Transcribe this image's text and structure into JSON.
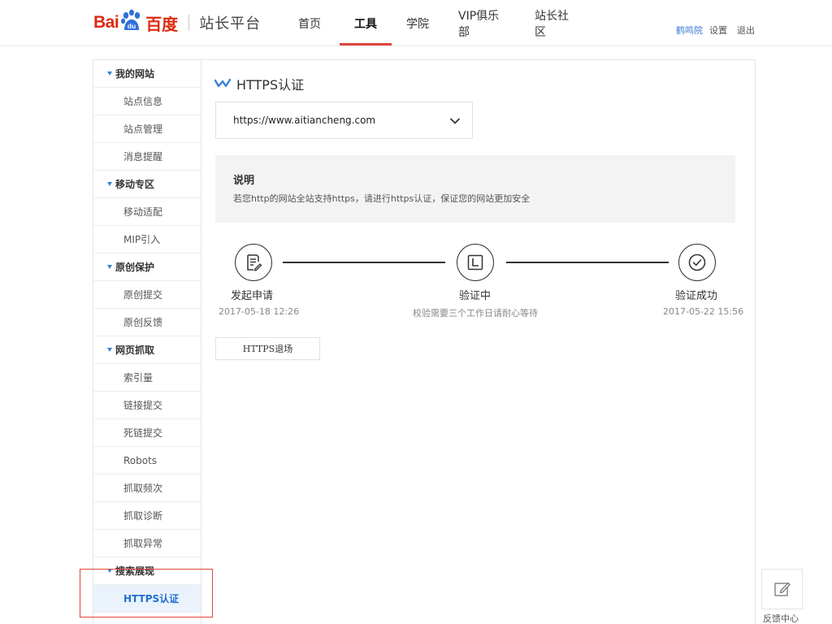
{
  "header": {
    "logo": {
      "bai": "Bai",
      "du": "du",
      "cn": "百度"
    },
    "platform": "站长平台",
    "nav": [
      "首页",
      "工具",
      "学院",
      "VIP俱乐部",
      "站长社区"
    ],
    "active_nav": "工具",
    "user": {
      "name": "鹤鸣院",
      "settings": "设置",
      "logout": "退出"
    }
  },
  "sidebar": {
    "groups": [
      {
        "label": "我的网站",
        "items": [
          "站点信息",
          "站点管理",
          "消息提醒"
        ]
      },
      {
        "label": "移动专区",
        "items": [
          "移动适配",
          "MIP引入"
        ]
      },
      {
        "label": "原创保护",
        "items": [
          "原创提交",
          "原创反馈"
        ]
      },
      {
        "label": "网页抓取",
        "items": [
          "索引量",
          "链接提交",
          "死链提交",
          "Robots",
          "抓取频次",
          "抓取诊断",
          "抓取异常"
        ]
      },
      {
        "label": "搜索展现",
        "items": [
          "HTTPS认证"
        ]
      }
    ],
    "active_item": "HTTPS认证"
  },
  "main": {
    "title": "HTTPS认证",
    "site_select": {
      "value": "https://www.aitiancheng.com"
    },
    "info": {
      "title": "说明",
      "text": "若您http的网站全站支持https，请进行https认证，保证您的网站更加安全"
    },
    "steps": [
      {
        "label": "发起申请",
        "sub": "2017-05-18 12:26",
        "icon": "document-edit-icon"
      },
      {
        "label": "验证中",
        "sub": "校验需要三个工作日请耐心等待",
        "icon": "clock-icon"
      },
      {
        "label": "验证成功",
        "sub": "2017-05-22 15:56",
        "icon": "check-circle-icon"
      }
    ],
    "exit_button": "HTTPS退场"
  },
  "feedback": {
    "label": "反馈中心",
    "icon": "edit-pencil-icon"
  },
  "colors": {
    "brand_red": "#de2910",
    "nav_active_underline": "#e0453a",
    "link_blue": "#3a7bd5",
    "sidebar_active_bg": "#eaf3fc",
    "sidebar_active_text": "#1f6fd1",
    "annotation_red": "#e0453a"
  }
}
